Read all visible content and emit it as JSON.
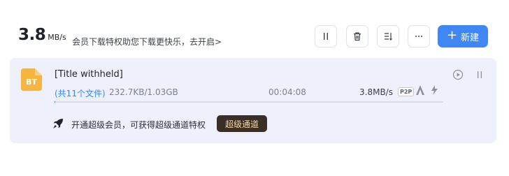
{
  "header": {
    "speed_value": "3.8",
    "speed_unit": "MB/s",
    "promo_text": "会员下载特权助您下载更快乐，去开启>",
    "new_label": "新建"
  },
  "task": {
    "title": "[Title withheld]",
    "file_count": "(共11个文件)",
    "size": "232.7KB/1.03GB",
    "eta": "00:04:08",
    "rate": "3.8MB/s",
    "p2p_badge": "P2P",
    "progress": 0.0002
  },
  "vip": {
    "text": "开通超级会员，可获得超级通道特权",
    "button_label": "超级通道"
  },
  "colors": {
    "accent": "#3f87f5",
    "card_bg": "#eef1fb",
    "vip_button": "#3a2f27",
    "vip_text": "#f6d9a5",
    "file_icon": "#f6b53f"
  },
  "icons": [
    "pause-icon",
    "trash-icon",
    "sort-icon",
    "more-icon",
    "plus-icon",
    "file-icon",
    "play-icon",
    "pause-icon",
    "accelerate-icon",
    "bolt-icon",
    "rocket-icon"
  ]
}
